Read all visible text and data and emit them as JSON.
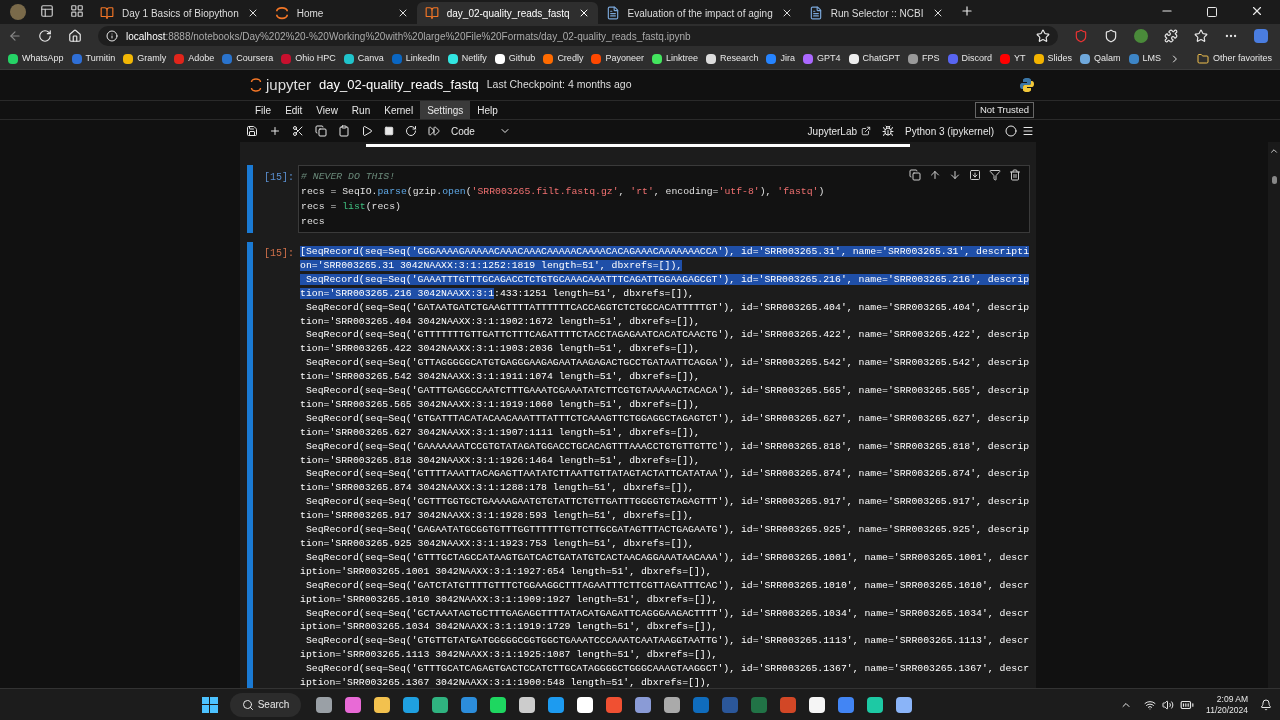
{
  "browser": {
    "tabs": [
      {
        "title": "Day 1 Basics of Biopython",
        "selected": false
      },
      {
        "title": "Home",
        "selected": false
      },
      {
        "title": "day_02-quality_reads_fastq",
        "selected": true
      },
      {
        "title": "Evaluation of the impact of aging",
        "selected": false
      },
      {
        "title": "Run Selector :: NCBI",
        "selected": false
      }
    ],
    "address": {
      "host": "localhost",
      "path": ":8888/notebooks/Day%202%20-%20Working%20with%20large%20File%20Formats/day_02-quality_reads_fastq.ipynb"
    },
    "bookmarks": [
      {
        "label": "WhatsApp",
        "color": "#25d366"
      },
      {
        "label": "Turnitin",
        "color": "#2f6fd6"
      },
      {
        "label": "Gramly",
        "color": "#f2b705"
      },
      {
        "label": "Adobe",
        "color": "#e1251b"
      },
      {
        "label": "Coursera",
        "color": "#2a73cc"
      },
      {
        "label": "Ohio HPC",
        "color": "#c8102e"
      },
      {
        "label": "Canva",
        "color": "#20c4cb"
      },
      {
        "label": "LinkedIn",
        "color": "#0a66c2"
      },
      {
        "label": "Netlify",
        "color": "#32e6e2"
      },
      {
        "label": "Github",
        "color": "#ffffff"
      },
      {
        "label": "Credly",
        "color": "#ff6b00"
      },
      {
        "label": "Payoneer",
        "color": "#ff4800"
      },
      {
        "label": "Linktree",
        "color": "#43e55e"
      },
      {
        "label": "Research",
        "color": "#dddddd"
      },
      {
        "label": "Jira",
        "color": "#2684ff"
      },
      {
        "label": "GPT4",
        "color": "#ab68ff"
      },
      {
        "label": "ChatGPT",
        "color": "#eeeeee"
      },
      {
        "label": "FPS",
        "color": "#999999"
      },
      {
        "label": "Discord",
        "color": "#5865f2"
      },
      {
        "label": "YT",
        "color": "#ff0000"
      },
      {
        "label": "Slides",
        "color": "#f4b400"
      },
      {
        "label": "Qalam",
        "color": "#6fa8dc"
      },
      {
        "label": "LMS",
        "color": "#3d85c6"
      }
    ],
    "other_favorites": "Other favorites"
  },
  "jupyter": {
    "logo": "jupyter",
    "notebook": "day_02-quality_reads_fastq",
    "checkpoint": "Last Checkpoint: 4 months ago",
    "menu": [
      {
        "label": "File",
        "selected": false
      },
      {
        "label": "Edit",
        "selected": false
      },
      {
        "label": "View",
        "selected": false
      },
      {
        "label": "Run",
        "selected": false
      },
      {
        "label": "Kernel",
        "selected": false
      },
      {
        "label": "Settings",
        "selected": true
      },
      {
        "label": "Help",
        "selected": false
      }
    ],
    "trust": "Not Trusted",
    "cell_type": "Code",
    "lab_link": "JupyterLab",
    "kernel": "Python 3 (ipykernel)"
  },
  "cell": {
    "in_prompt": "[15]:",
    "out_prompt": "[15]:",
    "code": [
      [
        {
          "kind": "comment",
          "text": "# NEVER DO THIS!"
        }
      ],
      [
        {
          "kind": "plain",
          "text": "recs = SeqIO."
        },
        {
          "kind": "func",
          "text": "parse"
        },
        {
          "kind": "plain",
          "text": "(gzip."
        },
        {
          "kind": "func",
          "text": "open"
        },
        {
          "kind": "plain",
          "text": "("
        },
        {
          "kind": "string",
          "text": "'SRR003265.filt.fastq.gz'"
        },
        {
          "kind": "plain",
          "text": ", "
        },
        {
          "kind": "string",
          "text": "'rt'"
        },
        {
          "kind": "plain",
          "text": ", encoding="
        },
        {
          "kind": "string",
          "text": "'utf-8'"
        },
        {
          "kind": "plain",
          "text": "), "
        },
        {
          "kind": "string",
          "text": "'fastq'"
        },
        {
          "kind": "plain",
          "text": ")"
        }
      ],
      [
        {
          "kind": "plain",
          "text": "recs = "
        },
        {
          "kind": "builtin",
          "text": "list"
        },
        {
          "kind": "plain",
          "text": "(recs)"
        }
      ],
      [
        {
          "kind": "plain",
          "text": "recs"
        }
      ]
    ],
    "output": [
      {
        "hl": "[SeqRecord(seq=Seq('GGGAAAAGAAAAACAAACAAACAAAAACAAAACACAGAAACAAAAAAACCA'), id='SRR003265.31', name='SRR003265.31', descripti"
      },
      {
        "hl": "on='SRR003265.31 3042NAAXX:3:1:1252:1819 length=51', dbxrefs=[]),"
      },
      {
        "hl": " SeqRecord(seq=Seq('GAAATTTGTTTGCAGACCTCTGTGCAAACAAATTTCAGATTGGAAGAGCGT'), id='SRR003265.216', name='SRR003265.216', descrip"
      },
      {
        "hl": "tion='SRR003265.216 3042NAAXX:3:1",
        "text": ":433:1251 length=51', dbxrefs=[]),"
      },
      {
        "text": " SeqRecord(seq=Seq('GATAATGATCTGAAGTTTTATTTTTTCACCAGGTCTCTGCCACATTTTTGT'), id='SRR003265.404', name='SRR003265.404', descrip"
      },
      {
        "text": "tion='SRR003265.404 3042NAAXX:3:1:1902:1672 length=51', dbxrefs=[]),"
      },
      {
        "text": " SeqRecord(seq=Seq('GTTTTTTTGTTGATTCTTTCAGATTTTCTACCTAGAGAATCACATCAACTG'), id='SRR003265.422', name='SRR003265.422', descrip"
      },
      {
        "text": "tion='SRR003265.422 3042NAAXX:3:1:1903:2036 length=51', dbxrefs=[]),"
      },
      {
        "text": " SeqRecord(seq=Seq('GTTAGGGGGCATGTGAGGGAAGAGAATAAGAGACTGCCTGATAATTCAGGA'), id='SRR003265.542', name='SRR003265.542', descrip"
      },
      {
        "text": "tion='SRR003265.542 3042NAAXX:3:1:1911:1074 length=51', dbxrefs=[]),"
      },
      {
        "text": " SeqRecord(seq=Seq('GATTTGAGGCCAATCTTTGAAATCGAAATATCTTCGTGTAAAAACTACACA'), id='SRR003265.565', name='SRR003265.565', descrip"
      },
      {
        "text": "tion='SRR003265.565 3042NAAXX:3:1:1919:1060 length=51', dbxrefs=[]),"
      },
      {
        "text": " SeqRecord(seq=Seq('GTGATTTACATACAACAAATTTATTTCTCAAAGTTCTGGAGGCTAGAGTCT'), id='SRR003265.627', name='SRR003265.627', descrip"
      },
      {
        "text": "tion='SRR003265.627 3042NAAXX:3:1:1907:1111 length=51', dbxrefs=[]),"
      },
      {
        "text": " SeqRecord(seq=Seq('GAAAAAAATCCGTGTATAGATGGACCTGCACAGTTTAAACCTGTGTTGTTC'), id='SRR003265.818', name='SRR003265.818', descrip"
      },
      {
        "text": "tion='SRR003265.818 3042NAAXX:3:1:1926:1464 length=51', dbxrefs=[]),"
      },
      {
        "text": " SeqRecord(seq=Seq('GTTTTAAATTACAGAGTTAATATCTTAATTGTTATAGTACTATTCATATAA'), id='SRR003265.874', name='SRR003265.874', descrip"
      },
      {
        "text": "tion='SRR003265.874 3042NAAXX:3:1:1288:178 length=51', dbxrefs=[]),"
      },
      {
        "text": " SeqRecord(seq=Seq('GGTTTGGTGCTGAAAAGAATGTGTATTCTGTTGATTTGGGGTGTAGAGTTT'), id='SRR003265.917', name='SRR003265.917', descrip"
      },
      {
        "text": "tion='SRR003265.917 3042NAAXX:3:1:1928:593 length=51', dbxrefs=[]),"
      },
      {
        "text": " SeqRecord(seq=Seq('GAGAATATGCGGTGTTTGGTTTTTTGTTCTTGCGATAGTTTACTGAGAATG'), id='SRR003265.925', name='SRR003265.925', descrip"
      },
      {
        "text": "tion='SRR003265.925 3042NAAXX:3:1:1923:753 length=51', dbxrefs=[]),"
      },
      {
        "text": " SeqRecord(seq=Seq('GTTTGCTAGCCATAAGTGATCACTGATATGTCACTAACAGGAAATAACAAA'), id='SRR003265.1001', name='SRR003265.1001', descr"
      },
      {
        "text": "iption='SRR003265.1001 3042NAAXX:3:1:1927:654 length=51', dbxrefs=[]),"
      },
      {
        "text": " SeqRecord(seq=Seq('GATCTATGTTTTGTTTCTGGAAGGCTTTAGAATTTCTTCGTTAGATTTCAC'), id='SRR003265.1010', name='SRR003265.1010', descr"
      },
      {
        "text": "iption='SRR003265.1010 3042NAAXX:3:1:1909:1927 length=51', dbxrefs=[]),"
      },
      {
        "text": " SeqRecord(seq=Seq('GCTAAATAGTGCTTTGAGAGGTTTTATACATGAGATTCAGGGAAGACTTTT'), id='SRR003265.1034', name='SRR003265.1034', descr"
      },
      {
        "text": "iption='SRR003265.1034 3042NAAXX:3:1:1919:1729 length=51', dbxrefs=[]),"
      },
      {
        "text": " SeqRecord(seq=Seq('GTGTTGTATGATGGGGGCGGTGGCTGAAATCCCAAATCAATAAGGTAATTG'), id='SRR003265.1113', name='SRR003265.1113', descr"
      },
      {
        "text": "iption='SRR003265.1113 3042NAAXX:3:1:1925:1087 length=51', dbxrefs=[]),"
      },
      {
        "text": " SeqRecord(seq=Seq('GTTTGCATCAGAGTGACTCCATCTTGCATAGGGGCTGGGCAAAGTAAGGCT'), id='SRR003265.1367', name='SRR003265.1367', descr"
      },
      {
        "text": "iption='SRR003265.1367 3042NAAXX:3:1:1900:548 length=51', dbxrefs=[]),"
      }
    ]
  },
  "taskbar": {
    "search": "Search",
    "time": "2:09 AM",
    "date": "11/20/2024",
    "apps": [
      {
        "color": "#9aa0a6"
      },
      {
        "color": "#e86ad6"
      },
      {
        "color": "#f2c14e"
      },
      {
        "color": "#1fa0e0"
      },
      {
        "color": "#2fb380"
      },
      {
        "color": "#2c8ddb"
      },
      {
        "color": "#1ed760"
      },
      {
        "color": "#cccccc"
      },
      {
        "color": "#1d9bf0"
      },
      {
        "color": "#ffffff"
      },
      {
        "color": "#f05032"
      },
      {
        "color": "#8a9bd6"
      },
      {
        "color": "#aaaaaa"
      },
      {
        "color": "#0f6cbd"
      },
      {
        "color": "#2b579a"
      },
      {
        "color": "#217346"
      },
      {
        "color": "#d24726"
      },
      {
        "color": "#f5f5f5"
      },
      {
        "color": "#4285f4"
      },
      {
        "color": "#1dc9a4"
      },
      {
        "color": "#8ab4f8"
      }
    ]
  }
}
